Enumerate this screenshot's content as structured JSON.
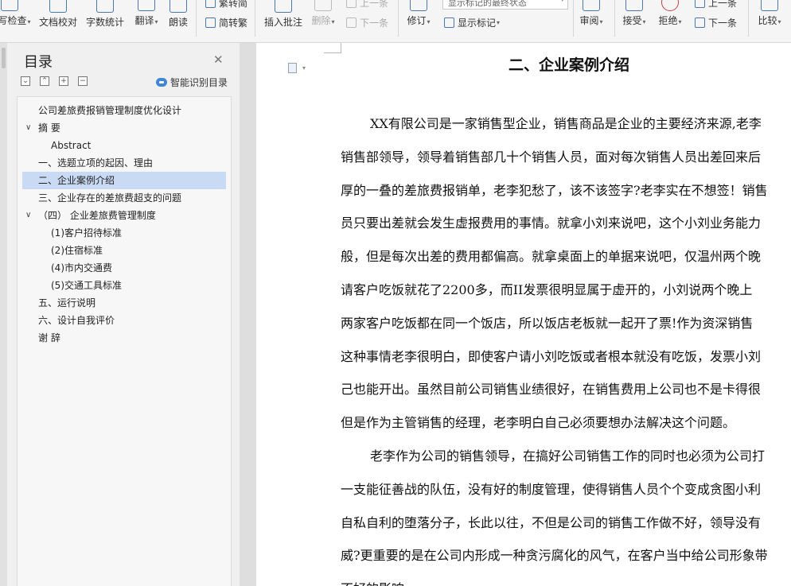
{
  "ribbon": {
    "buttons": [
      {
        "name": "spell-check-button",
        "label": "拼写检查",
        "caret": true
      },
      {
        "name": "doc-proofread-button",
        "label": "文档校对",
        "caret": false
      },
      {
        "name": "word-count-button",
        "label": "字数统计",
        "caret": false
      },
      {
        "name": "translate-button",
        "label": "翻译",
        "caret": true
      },
      {
        "name": "read-aloud-button",
        "label": "朗读",
        "caret": false
      }
    ],
    "trad_simp": "繁转简",
    "simp_trad": "简转繁",
    "insert_comment": "插入批注",
    "delete": "删除",
    "prev_comment": "上一条",
    "next_comment": "下一条",
    "track_changes": "修订",
    "display_status": "显示标记的最终状态",
    "show_markup": "显示标记",
    "review": "审阅",
    "accept": "接受",
    "reject": "拒绝",
    "prev_change": "上一条",
    "next_change": "下一条",
    "compare": "比较"
  },
  "sidebar": {
    "title": "目录",
    "smart_toc": "智能识别目录",
    "items": [
      {
        "label": "公司差旅费报销管理制度优化设计",
        "level": 1,
        "toggle": "",
        "selected": false
      },
      {
        "label": "摘  要",
        "level": 1,
        "toggle": "∨",
        "selected": false
      },
      {
        "label": "Abstract",
        "level": 2,
        "toggle": "",
        "selected": false
      },
      {
        "label": "一、选题立项的起因、理由",
        "level": 1,
        "toggle": "",
        "selected": false
      },
      {
        "label": "二、企业案例介绍",
        "level": 1,
        "toggle": "",
        "selected": true
      },
      {
        "label": "三、企业存在的差旅费超支的问题",
        "level": 1,
        "toggle": "",
        "selected": false
      },
      {
        "label": "（四） 企业差旅费管理制度",
        "level": 1,
        "toggle": "∨",
        "selected": false
      },
      {
        "label": "(1)客户招待标准",
        "level": 2,
        "toggle": "",
        "selected": false
      },
      {
        "label": "(2)住宿标准",
        "level": 2,
        "toggle": "",
        "selected": false
      },
      {
        "label": "(4)市内交通费",
        "level": 2,
        "toggle": "",
        "selected": false
      },
      {
        "label": "(5)交通工具标准",
        "level": 2,
        "toggle": "",
        "selected": false
      },
      {
        "label": "五、运行说明",
        "level": 1,
        "toggle": "",
        "selected": false
      },
      {
        "label": "六、设计自我评价",
        "level": 1,
        "toggle": "",
        "selected": false
      },
      {
        "label": "谢  辞",
        "level": 1,
        "toggle": "",
        "selected": false
      }
    ]
  },
  "document": {
    "heading": "二、企业案例介绍",
    "lines": [
      {
        "text": "XX有限公司是一家销售型企业，销售商品是企业的主要经济来源,老李",
        "indent": true
      },
      {
        "text": "销售部领导，领导着销售部几十个销售人员，面对每次销售人员出差回来后",
        "indent": false
      },
      {
        "text": "厚的一叠的差旅费报销单，老李犯愁了，该不该签字?老李实在不想签！销售",
        "indent": false
      },
      {
        "text": "员只要出差就会发生虚报费用的事情。就拿小刘来说吧，这个小刘业务能力",
        "indent": false
      },
      {
        "text": "般，但是每次出差的费用都偏高。就拿桌面上的单据来说吧，仅温州两个晚",
        "indent": false
      },
      {
        "text": "请客户吃饭就花了2200多，而II发票很明显属于虚开的，小刘说两个晚上",
        "indent": false
      },
      {
        "text": "两家客户吃饭都在同一个饭店，所以饭店老板就一起开了票!作为资深销售",
        "indent": false
      },
      {
        "text": "这种事情老李很明白，即使客户请小刘吃饭或者根本就没有吃饭，发票小刘",
        "indent": false
      },
      {
        "text": "己也能开出。虽然目前公司销售业绩很好，在销售费用上公司也不是卡得很",
        "indent": false
      },
      {
        "text": "但是作为主管销售的经理，老李明白自己必须要想办法解决这个问题。",
        "indent": false
      },
      {
        "text": "老李作为公司的销售领导，在搞好公司销售工作的同时也必须为公司打",
        "indent": true
      },
      {
        "text": "一支能征善战的队伍，没有好的制度管理，使得销售人员个个变成贪图小利",
        "indent": false
      },
      {
        "text": "自私自利的堕落分子，长此以往，不但是公司的销售工作做不好，领导没有",
        "indent": false
      },
      {
        "text": "威?更重要的是在公司内形成一种贪污腐化的风气，在客户当中给公司形象带",
        "indent": false
      },
      {
        "text": "不好的影响。",
        "indent": false
      }
    ]
  }
}
